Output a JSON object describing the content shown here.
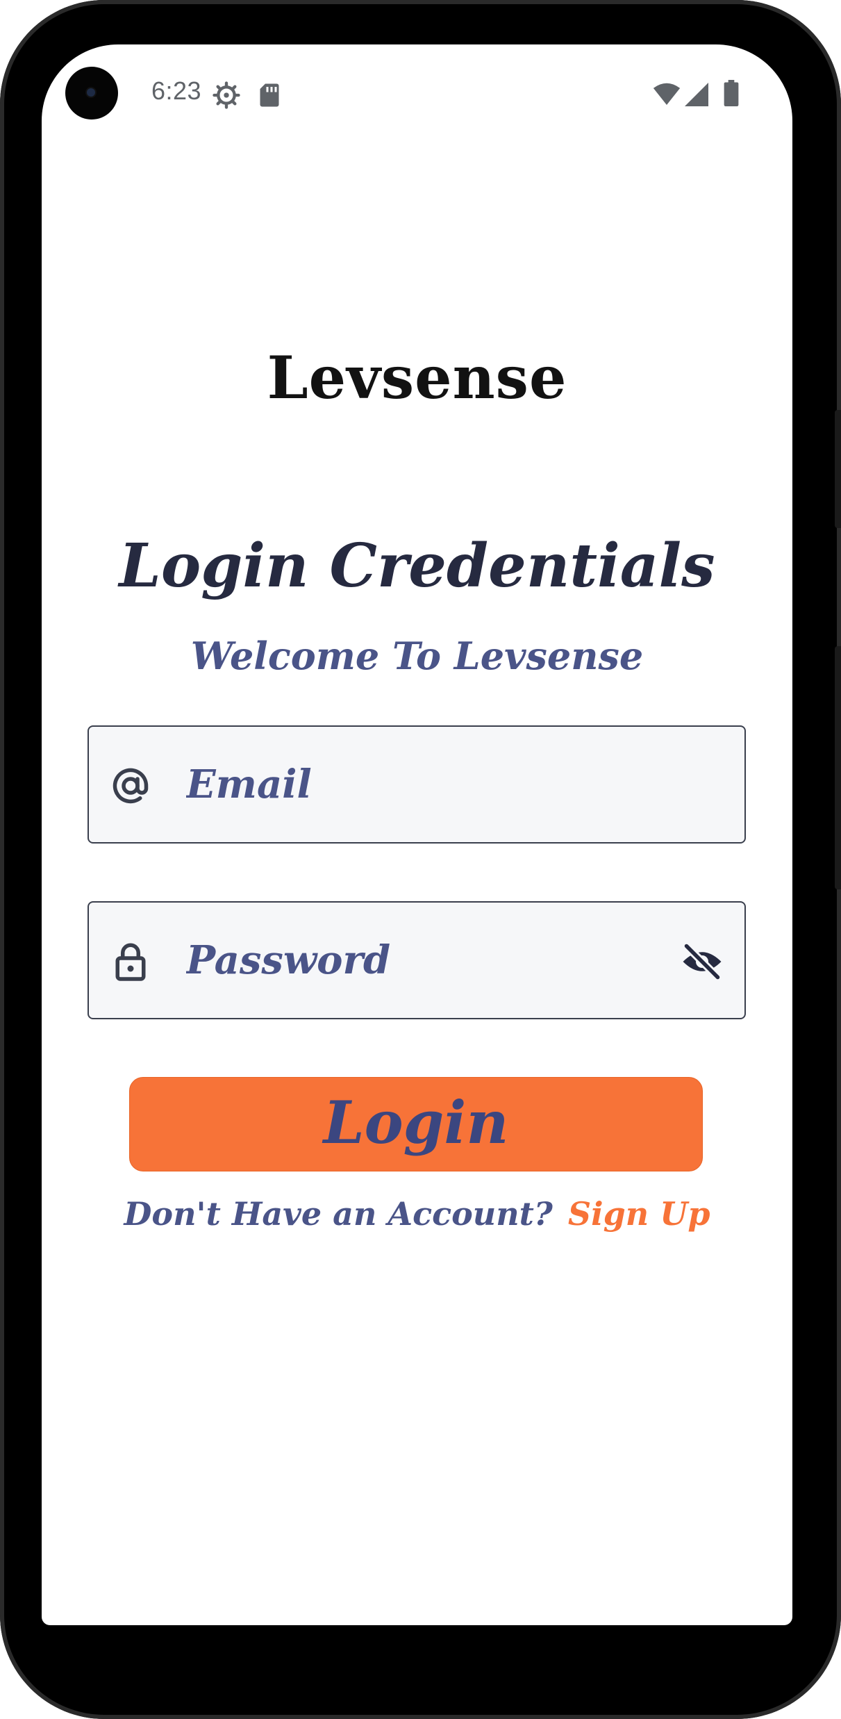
{
  "status_bar": {
    "time": "6:23",
    "icons": [
      "settings-gear-icon",
      "sd-card-icon",
      "wifi-icon",
      "cell-signal-icon",
      "battery-icon"
    ]
  },
  "app": {
    "brand": "Levsense",
    "title": "Login Credentials",
    "subtitle": "Welcome To Levsense"
  },
  "form": {
    "email": {
      "value": "",
      "placeholder": "Email",
      "icon": "at-sign-icon"
    },
    "password": {
      "value": "",
      "placeholder": "Password",
      "icon": "lock-icon",
      "toggle_icon": "eye-off-icon"
    },
    "login_label": "Login"
  },
  "signup": {
    "prompt": "Don't Have an Account?",
    "link_label": "Sign Up"
  },
  "colors": {
    "accent": "#f77338",
    "primary_text": "#262a40",
    "secondary_text": "#4a5488",
    "field_bg": "#f6f7f9"
  }
}
